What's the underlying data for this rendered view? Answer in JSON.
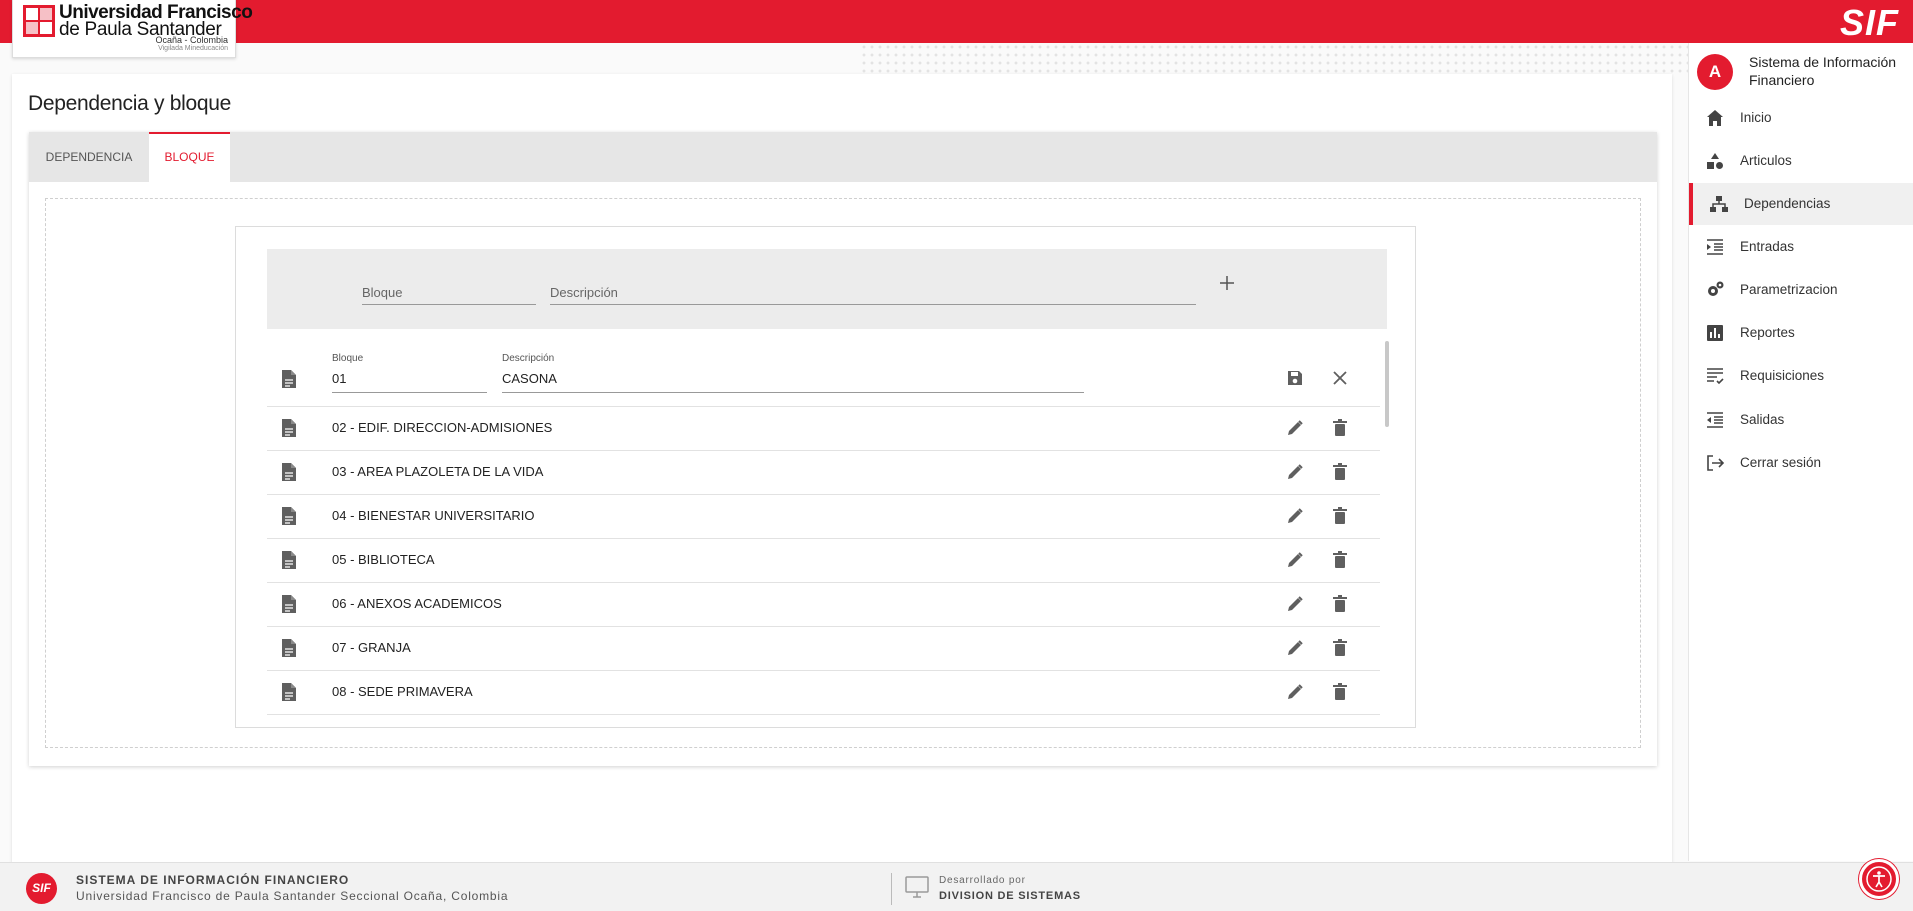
{
  "header": {
    "university_line1": "Universidad Francisco",
    "university_line2": "de Paula Santander",
    "university_line3": "Ocaña - Colombia",
    "university_line4": "Vigilada Mineducación",
    "brand": "SIF"
  },
  "page": {
    "title": "Dependencia y bloque",
    "tabs": [
      {
        "label": "DEPENDENCIA"
      },
      {
        "label": "BLOQUE"
      }
    ]
  },
  "add_form": {
    "bloque_placeholder": "Bloque",
    "descripcion_placeholder": "Descripción",
    "add_icon": "plus-icon"
  },
  "edit_row": {
    "bloque_label": "Bloque",
    "bloque_value": "01",
    "descripcion_label": "Descripción",
    "descripcion_value": "CASONA"
  },
  "rows": [
    {
      "text": "02 - EDIF. DIRECCION-ADMISIONES"
    },
    {
      "text": "03 - AREA PLAZOLETA DE LA VIDA"
    },
    {
      "text": "04 - BIENESTAR UNIVERSITARIO"
    },
    {
      "text": "05 - BIBLIOTECA"
    },
    {
      "text": "06 - ANEXOS ACADEMICOS"
    },
    {
      "text": "07 - GRANJA"
    },
    {
      "text": "08 - SEDE PRIMAVERA"
    }
  ],
  "sidebar": {
    "avatar": "A",
    "title": "Sistema de Información Financiero",
    "items": [
      {
        "label": "Inicio",
        "icon": "home-icon"
      },
      {
        "label": "Articulos",
        "icon": "shapes-icon"
      },
      {
        "label": "Dependencias",
        "icon": "sitemap-icon",
        "active": true
      },
      {
        "label": "Entradas",
        "icon": "indent-icon"
      },
      {
        "label": "Parametrizacion",
        "icon": "gears-icon"
      },
      {
        "label": "Reportes",
        "icon": "bar-chart-icon"
      },
      {
        "label": "Requisiciones",
        "icon": "checklist-icon"
      },
      {
        "label": "Salidas",
        "icon": "outdent-icon"
      },
      {
        "label": "Cerrar sesión",
        "icon": "logout-icon"
      }
    ]
  },
  "footer": {
    "logo_text": "SIF",
    "title": "SISTEMA DE INFORMACIÓN FINANCIERO",
    "subtitle": "Universidad Francisco de Paula Santander Seccional Ocaña, Colombia",
    "dev_label": "Desarrollado por",
    "dev_name": "DIVISION DE SISTEMAS"
  },
  "colors": {
    "accent": "#e31b2f",
    "icon": "#5f5f5f"
  }
}
